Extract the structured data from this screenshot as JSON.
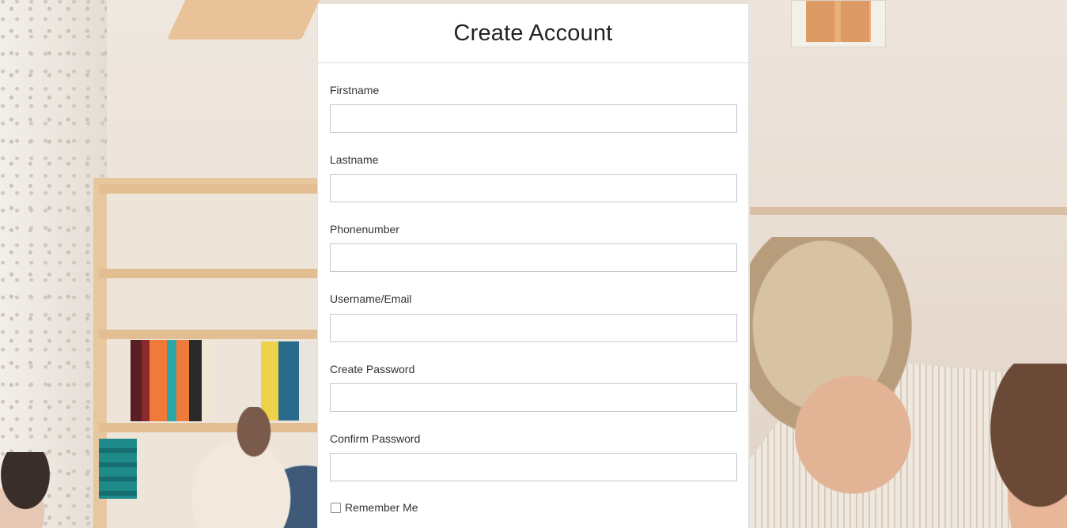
{
  "form": {
    "title": "Create Account",
    "fields": [
      {
        "label": "Firstname",
        "value": "",
        "placeholder": ""
      },
      {
        "label": "Lastname",
        "value": "",
        "placeholder": ""
      },
      {
        "label": "Phonenumber",
        "value": "",
        "placeholder": ""
      },
      {
        "label": "Username/Email",
        "value": "",
        "placeholder": ""
      },
      {
        "label": "Create Password",
        "value": "",
        "placeholder": ""
      },
      {
        "label": "Confirm Password",
        "value": "",
        "placeholder": ""
      }
    ],
    "remember_me": {
      "label": "Remember Me",
      "checked": false
    }
  },
  "colors": {
    "panel_background": "#ffffff",
    "title_text": "#222222",
    "label_text": "#333333",
    "input_border": "#c8c8c8"
  }
}
